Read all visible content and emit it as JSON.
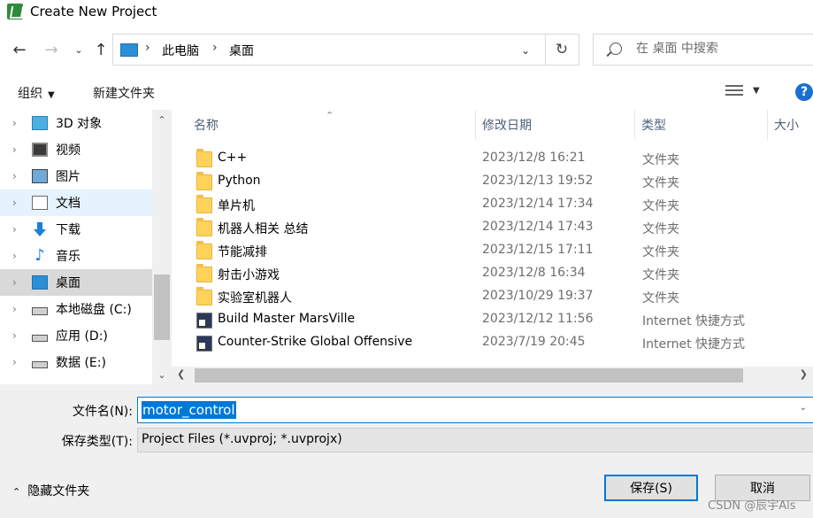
{
  "window": {
    "title": "Create New Project"
  },
  "nav": {
    "back_icon": "arrow-left-icon",
    "forward_icon": "arrow-right-icon",
    "recent_icon": "chevron-down-icon",
    "up_icon": "arrow-up-icon",
    "address": [
      "此电脑",
      "桌面"
    ],
    "search_placeholder": "在 桌面 中搜索"
  },
  "toolbar": {
    "organize": "组织",
    "new_folder": "新建文件夹",
    "help": "?"
  },
  "sidebar": {
    "items": [
      {
        "label": "3D 对象",
        "icon": "3d-objects-icon"
      },
      {
        "label": "视频",
        "icon": "video-icon"
      },
      {
        "label": "图片",
        "icon": "pictures-icon"
      },
      {
        "label": "文档",
        "icon": "documents-icon"
      },
      {
        "label": "下载",
        "icon": "downloads-icon"
      },
      {
        "label": "音乐",
        "icon": "music-icon"
      },
      {
        "label": "桌面",
        "icon": "desktop-icon"
      },
      {
        "label": "本地磁盘 (C:)",
        "icon": "drive-icon"
      },
      {
        "label": "应用 (D:)",
        "icon": "drive-icon"
      },
      {
        "label": "数据 (E:)",
        "icon": "drive-icon"
      }
    ]
  },
  "filelist": {
    "columns": {
      "name": "名称",
      "date": "修改日期",
      "type": "类型",
      "size": "大小"
    },
    "rows": [
      {
        "name": "C++",
        "date": "2023/12/8 16:21",
        "type": "文件夹",
        "kind": "folder"
      },
      {
        "name": "Python",
        "date": "2023/12/13 19:52",
        "type": "文件夹",
        "kind": "folder"
      },
      {
        "name": "单片机",
        "date": "2023/12/14 17:34",
        "type": "文件夹",
        "kind": "folder"
      },
      {
        "name": "机器人相关 总结",
        "date": "2023/12/14 17:43",
        "type": "文件夹",
        "kind": "folder"
      },
      {
        "name": "节能减排",
        "date": "2023/12/15 17:11",
        "type": "文件夹",
        "kind": "folder"
      },
      {
        "name": "射击小游戏",
        "date": "2023/12/8 16:34",
        "type": "文件夹",
        "kind": "folder"
      },
      {
        "name": "实验室机器人",
        "date": "2023/10/29 19:37",
        "type": "文件夹",
        "kind": "folder"
      },
      {
        "name": "Build Master MarsVille",
        "date": "2023/12/12 11:56",
        "type": "Internet 快捷方式",
        "kind": "shortcut"
      },
      {
        "name": "Counter-Strike Global Offensive",
        "date": "2023/7/19 20:45",
        "type": "Internet 快捷方式",
        "kind": "shortcut"
      }
    ]
  },
  "form": {
    "filename_label": "文件名(N):",
    "filename_value": "motor_control",
    "filetype_label": "保存类型(T):",
    "filetype_value": "Project Files (*.uvproj; *.uvprojx)"
  },
  "footer": {
    "hide_folders": "隐藏文件夹",
    "save": "保存(S)",
    "cancel": "取消",
    "watermark": "CSDN @辰宇Als"
  }
}
